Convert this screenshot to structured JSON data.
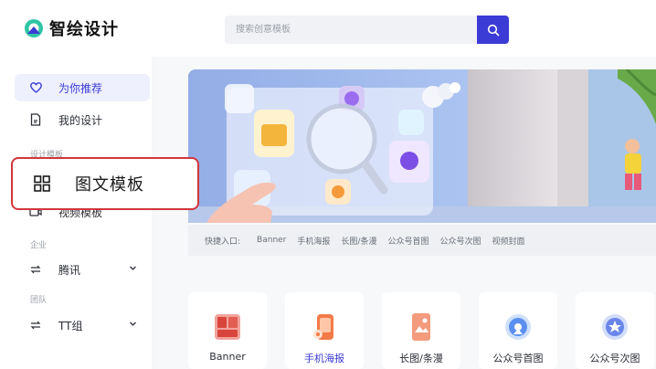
{
  "header": {
    "brand": "智绘设计",
    "search": {
      "placeholder": "搜索创意模板"
    }
  },
  "sidebar": {
    "items": [
      {
        "label": "为你推荐",
        "icon": "heart-icon",
        "active": true
      },
      {
        "label": "我的设计",
        "icon": "document-icon"
      }
    ],
    "group_design": "设计模板",
    "video_item": {
      "label": "视频模板",
      "icon": "video-icon"
    },
    "group_company": "企业",
    "company_item": {
      "label": "腾讯",
      "icon": "switch-icon"
    },
    "group_team": "团队",
    "team_item": {
      "label": "TT组",
      "icon": "switch-icon"
    }
  },
  "highlight": {
    "label": "图文模板",
    "icon": "grid-icon",
    "color": "#d2363c"
  },
  "quick_entry": {
    "label": "快捷入口:",
    "links": [
      "Banner",
      "手机海报",
      "长图/条漫",
      "公众号首图",
      "公众号次图",
      "视频封面"
    ]
  },
  "cards": [
    {
      "label": "Banner",
      "icon": "banner-icon",
      "active": false
    },
    {
      "label": "手机海报",
      "icon": "phone-poster-icon",
      "active": true
    },
    {
      "label": "长图/条漫",
      "icon": "long-image-icon",
      "active": false
    },
    {
      "label": "公众号首图",
      "icon": "wechat-cover-icon",
      "active": false
    },
    {
      "label": "公众号次图",
      "icon": "wechat-secondary-icon",
      "active": false
    }
  ],
  "colors": {
    "accent": "#3b3bd6",
    "highlight": "#d2363c"
  }
}
